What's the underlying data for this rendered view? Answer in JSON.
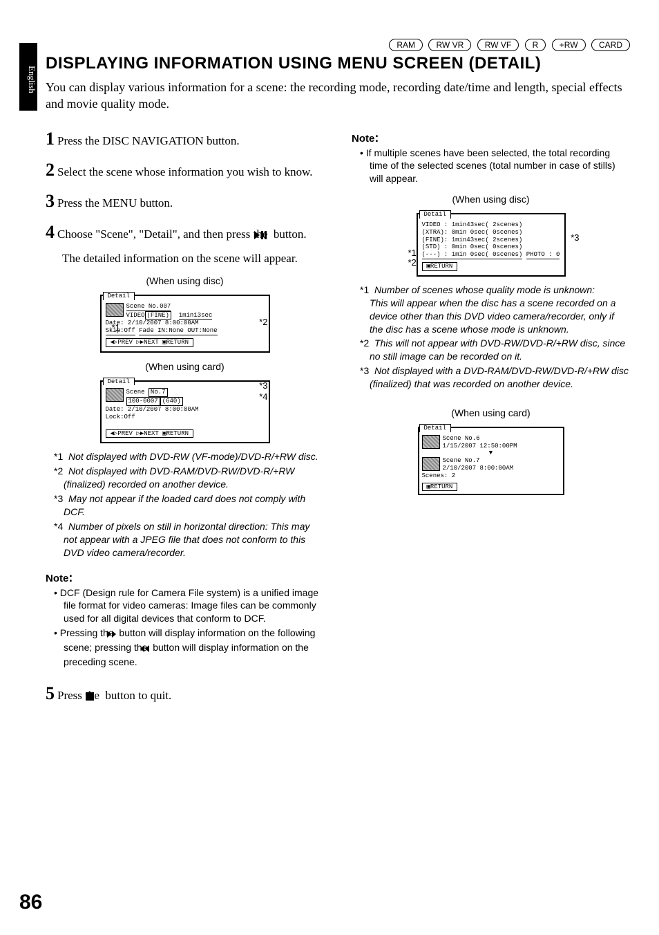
{
  "side_tab": "English",
  "badges": [
    "RAM",
    "RW VR",
    "RW VF",
    "R",
    "+RW",
    "CARD"
  ],
  "title": "DISPLAYING INFORMATION USING MENU SCREEN (DETAIL)",
  "intro": "You can display various information for a scene: the recording mode, recording date/time and length, special effects and movie quality mode.",
  "steps": {
    "s1": "Press the DISC NAVIGATION button.",
    "s2": "Select the scene whose information you wish to know.",
    "s3": "Press the MENU button.",
    "s4a": "Choose \"Scene\", \"Detail\", and then press the",
    "s4b": "button.",
    "s4_after": "The detailed information on the scene will appear.",
    "s5a": "Press the",
    "s5b": "button to quit."
  },
  "captions": {
    "disc1": "(When using disc)",
    "card1": "(When using card)",
    "disc2": "(When using disc)",
    "card2": "(When using card)"
  },
  "screen_disc_detail": {
    "tab": "Detail",
    "l1": "Scene No.007",
    "l2a": "VIDEO",
    "l2b": "(FINE)",
    "l2c": "1min13sec",
    "l3": "Date: 2/10/2007  8:00:00AM",
    "l4": "Skip:Off",
    "l5": "Fade IN:None OUT:None",
    "footer": "◀▷PREV ▷▶NEXT ▣RETURN"
  },
  "screen_card_detail": {
    "tab": "Detail",
    "l1a": "Scene",
    "l1b": "No.7",
    "l2a": "100-0007",
    "l2b": "(640)",
    "l3": "Date: 2/10/2007  8:00:00AM",
    "l4": "Lock:Off",
    "footer": "◀▷PREV ▷▶NEXT ▣RETURN"
  },
  "left_foot": {
    "f1n": "*1",
    "f1t": "Not displayed with DVD-RW (VF-mode)/DVD-R/+RW disc.",
    "f2n": "*2",
    "f2t": "Not displayed with DVD-RAM/DVD-RW/DVD-R/+RW (finalized) recorded on another device.",
    "f3n": "*3",
    "f3t": "May not appear if the loaded card does not comply with DCF.",
    "f4n": "*4",
    "f4t": "Number of pixels on still in horizontal direction: This may not appear with a JPEG file that does not conform to this DVD video camera/recorder."
  },
  "note1": {
    "head": "Note",
    "b1": "DCF (Design rule for Camera File system) is a unified image file format for video cameras: Image files can be commonly used for all digital devices that conform to DCF.",
    "b2a": "Pressing the",
    "b2b": "button will display information on the following scene; pressing the",
    "b2c": "button will display information on the preceding scene."
  },
  "note2": {
    "head": "Note",
    "b1": "If multiple scenes have been selected, the total recording time of the selected scenes (total number in case of stills) will appear."
  },
  "screen_disc_multi": {
    "tab": "Detail",
    "r1": "VIDEO : 1min43sec( 2scenes)",
    "r2": "(XTRA): 0min 0sec( 0scenes)",
    "r3": "(FINE): 1min43sec( 2scenes)",
    "r4": "(STD) : 0min 0sec( 0scenes)",
    "r5": "(---) : 1min 0sec( 0scenes)",
    "r6": "PHOTO : 0",
    "footer": "▣RETURN"
  },
  "right_foot": {
    "f1n": "*1",
    "f1t": "Number of scenes whose quality mode is unknown:",
    "f1b": "This will appear when the disc has a scene recorded on a device other than this DVD video camera/recorder, only if the disc has a scene whose mode is unknown.",
    "f2n": "*2",
    "f2t": "This will not appear with DVD-RW/DVD-R/+RW disc, since no still image can be recorded on it.",
    "f3n": "*3",
    "f3t": "Not displayed with a DVD-RAM/DVD-RW/DVD-R/+RW disc (finalized) that was recorded on another device."
  },
  "screen_card_multi": {
    "tab": "Detail",
    "r1": "Scene No.6",
    "r2": "1/15/2007 12:50:00PM",
    "r3": "Scene No.7",
    "r4": "2/10/2007  8:00:00AM",
    "r5": "Scenes: 2",
    "footer": "▣RETURN"
  },
  "callouts": {
    "s1": "*1",
    "s2": "*2",
    "s3": "*3",
    "s4": "*4"
  },
  "page_number": "86"
}
